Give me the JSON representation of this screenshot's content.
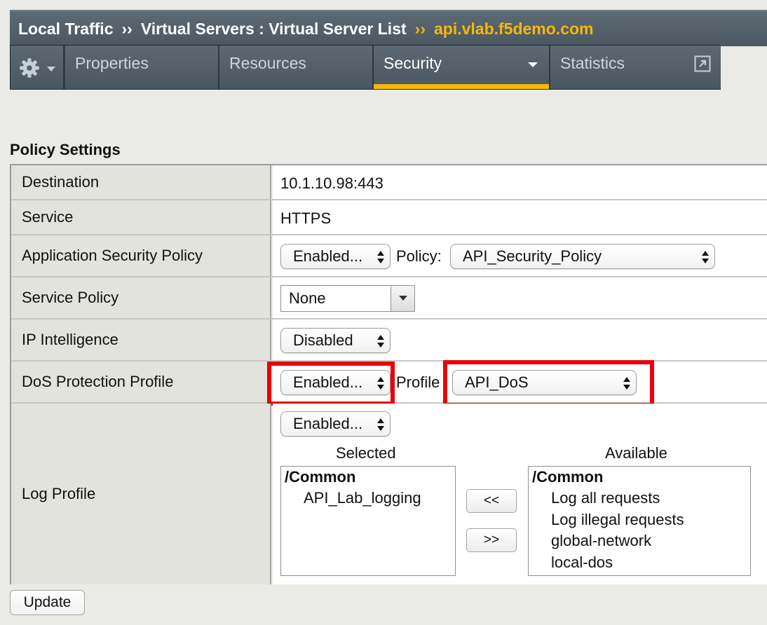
{
  "breadcrumb": {
    "items": [
      "Local Traffic",
      "Virtual Servers : Virtual Server List"
    ],
    "separator": "››",
    "current": "api.vlab.f5demo.com"
  },
  "tabs": {
    "properties": "Properties",
    "resources": "Resources",
    "security": "Security",
    "statistics": "Statistics",
    "active": "Security"
  },
  "section_title": "Policy Settings",
  "rows": {
    "destination": {
      "label": "Destination",
      "value": "10.1.10.98:443"
    },
    "service": {
      "label": "Service",
      "value": "HTTPS"
    },
    "app_security_policy": {
      "label": "Application Security Policy",
      "state": "Enabled...",
      "policy_label": "Policy:",
      "policy_value": "API_Security_Policy"
    },
    "service_policy": {
      "label": "Service Policy",
      "value": "None"
    },
    "ip_intelligence": {
      "label": "IP Intelligence",
      "value": "Disabled"
    },
    "dos_profile": {
      "label": "DoS Protection Profile",
      "state": "Enabled...",
      "profile_label": "Profile",
      "profile_value": "API_DoS"
    },
    "log_profile": {
      "label": "Log Profile",
      "state": "Enabled...",
      "selected_header": "Selected",
      "available_header": "Available",
      "selected": {
        "group": "/Common",
        "items": [
          "API_Lab_logging"
        ]
      },
      "available": {
        "group": "/Common",
        "items": [
          "Log all requests",
          "Log illegal requests",
          "global-network",
          "local-dos"
        ]
      },
      "move_left": "<<",
      "move_right": ">>"
    }
  },
  "update_button": "Update",
  "colors": {
    "accent": "#f5b80a",
    "highlight": "#e8000b",
    "tab_bg": "#4b5862"
  },
  "icons": {
    "settings": "gear-icon",
    "menu": "caret-down-icon",
    "popout": "popout-icon",
    "select": "updown-arrows-icon"
  }
}
